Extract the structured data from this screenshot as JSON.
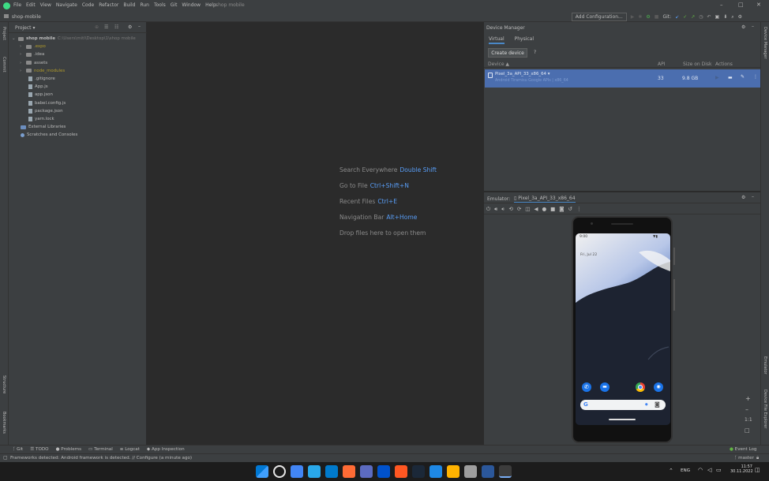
{
  "menu": {
    "items": [
      "File",
      "Edit",
      "View",
      "Navigate",
      "Code",
      "Refactor",
      "Build",
      "Run",
      "Tools",
      "Git",
      "Window",
      "Help"
    ],
    "window_title": "shop mobile"
  },
  "window_controls": {
    "minimize": "–",
    "maximize": "□",
    "close": "✕"
  },
  "toolbar": {
    "add_configuration": "Add Configuration...",
    "git_label": "Git:"
  },
  "project_tab": "shop-mobile",
  "left_strip": {
    "project": "Project",
    "commit": "Commit",
    "structure": "Structure",
    "bookmarks": "Bookmarks"
  },
  "right_strip": {
    "device_manager": "Device Manager",
    "emulator": "Emulator",
    "device_file_explorer": "Device File Explorer"
  },
  "project_panel": {
    "header": "Project",
    "tree": [
      {
        "label": "shop mobile",
        "path": "C:\\Users\\mitl\\Desktop\\1\\shop mobile",
        "type": "root",
        "indent": 0,
        "style": "normal"
      },
      {
        "label": ".expo",
        "type": "folder",
        "indent": 1,
        "style": "yellow"
      },
      {
        "label": ".idea",
        "type": "folder",
        "indent": 1,
        "style": "normal"
      },
      {
        "label": "assets",
        "type": "folder",
        "indent": 1,
        "style": "normal"
      },
      {
        "label": "node_modules",
        "type": "folder",
        "indent": 1,
        "style": "yellow"
      },
      {
        "label": ".gitignore",
        "type": "file",
        "indent": 1,
        "style": "normal"
      },
      {
        "label": "App.js",
        "type": "file",
        "indent": 1,
        "style": "normal"
      },
      {
        "label": "app.json",
        "type": "file",
        "indent": 1,
        "style": "normal"
      },
      {
        "label": "babel.config.js",
        "type": "file",
        "indent": 1,
        "style": "normal"
      },
      {
        "label": "package.json",
        "type": "file",
        "indent": 1,
        "style": "normal"
      },
      {
        "label": "yarn.lock",
        "type": "file",
        "indent": 1,
        "style": "normal"
      },
      {
        "label": "External Libraries",
        "type": "lib",
        "indent": 0,
        "style": "normal"
      },
      {
        "label": "Scratches and Consoles",
        "type": "scratch",
        "indent": 0,
        "style": "normal"
      }
    ]
  },
  "editor_hints": [
    {
      "text": "Search Everywhere",
      "key": "Double Shift"
    },
    {
      "text": "Go to File",
      "key": "Ctrl+Shift+N"
    },
    {
      "text": "Recent Files",
      "key": "Ctrl+E"
    },
    {
      "text": "Navigation Bar",
      "key": "Alt+Home"
    },
    {
      "text": "Drop files here to open them",
      "key": ""
    }
  ],
  "device_manager": {
    "title": "Device Manager",
    "tabs": [
      "Virtual",
      "Physical"
    ],
    "create_button": "Create device",
    "help": "?",
    "columns": [
      "Device ▲",
      "API",
      "Size on Disk",
      "Actions"
    ],
    "devices": [
      {
        "name": "Pixel_3a_API_33_x86_64 ▾",
        "subtitle": "Android Tiramisu Google APIs | x86_64",
        "api": "33",
        "size": "9.8 GB"
      }
    ]
  },
  "emulator": {
    "tabs": [
      "Emulator:",
      "Pixel_3a_API_33_x86_64"
    ],
    "phone": {
      "time": "9:00",
      "date": "Fri, Jul 22",
      "search_icon": "G"
    }
  },
  "bottom_tools": [
    "Git",
    "TODO",
    "Problems",
    "Terminal",
    "Logcat",
    "App Inspection"
  ],
  "bottom_right": {
    "event_log": "Event Log",
    "branch": "master"
  },
  "status_message": "Frameworks detected: Android framework is detected. // Configure (a minute ago)",
  "taskbar": {
    "app_colors": [
      "#0078d4",
      "#e8e8e8",
      "#4285f4",
      "#29a8ea",
      "#007acc",
      "#ff6b35",
      "#5c6bc0",
      "#0052cc",
      "#ff5722",
      "#1b2838",
      "#1e88e5",
      "#ffb300",
      "#9e9e9e",
      "#2b579a",
      "#3c3c3c"
    ],
    "tray": {
      "lang": "ENG",
      "time": "11:57",
      "date": "30.11.2022"
    }
  }
}
